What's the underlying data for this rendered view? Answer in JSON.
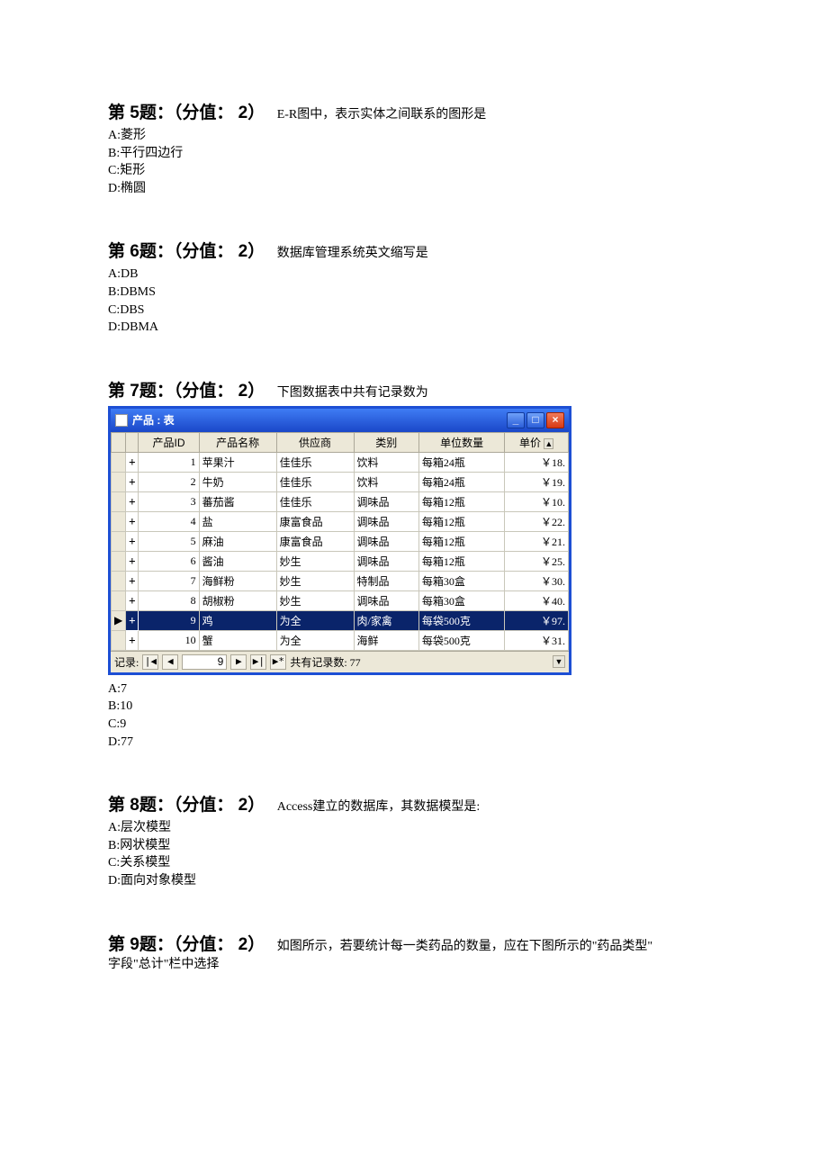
{
  "q5": {
    "title": "第 5题：（分值： 2）",
    "text": "E-R图中，表示实体之间联系的图形是",
    "opts": [
      "A:菱形",
      "B:平行四边行",
      "C:矩形",
      "D:椭圆"
    ]
  },
  "q6": {
    "title": "第 6题：（分值： 2）",
    "text": "数据库管理系统英文缩写是",
    "opts": [
      "A:DB",
      "B:DBMS",
      "C:DBS",
      "D:DBMA"
    ]
  },
  "q7": {
    "title": "第 7题：（分值： 2）",
    "text": "下图数据表中共有记录数为",
    "opts": [
      "A:7",
      "B:10",
      "C:9",
      "D:77"
    ]
  },
  "q8": {
    "title": "第 8题：（分值： 2）",
    "text": "Access建立的数据库，其数据模型是:",
    "opts": [
      "A:层次模型",
      "B:网状模型",
      "C:关系模型",
      "D:面向对象模型"
    ]
  },
  "q9": {
    "title": "第 9题：（分值： 2）",
    "text": "如图所示，若要统计每一类药品的数量，应在下图所示的\"药品类型\"",
    "tail": "字段\"总计\"栏中选择"
  },
  "table": {
    "window_title": "产品 : 表",
    "headers": [
      "产品ID",
      "产品名称",
      "供应商",
      "类别",
      "单位数量",
      "单价"
    ],
    "rows": [
      {
        "id": "1",
        "name": "苹果汁",
        "sup": "佳佳乐",
        "cat": "饮料",
        "unit": "每箱24瓶",
        "price": "￥18."
      },
      {
        "id": "2",
        "name": "牛奶",
        "sup": "佳佳乐",
        "cat": "饮料",
        "unit": "每箱24瓶",
        "price": "￥19."
      },
      {
        "id": "3",
        "name": "蕃茄酱",
        "sup": "佳佳乐",
        "cat": "调味品",
        "unit": "每箱12瓶",
        "price": "￥10."
      },
      {
        "id": "4",
        "name": "盐",
        "sup": "康富食品",
        "cat": "调味品",
        "unit": "每箱12瓶",
        "price": "￥22."
      },
      {
        "id": "5",
        "name": "麻油",
        "sup": "康富食品",
        "cat": "调味品",
        "unit": "每箱12瓶",
        "price": "￥21."
      },
      {
        "id": "6",
        "name": "酱油",
        "sup": "妙生",
        "cat": "调味品",
        "unit": "每箱12瓶",
        "price": "￥25."
      },
      {
        "id": "7",
        "name": "海鲜粉",
        "sup": "妙生",
        "cat": "特制品",
        "unit": "每箱30盒",
        "price": "￥30."
      },
      {
        "id": "8",
        "name": "胡椒粉",
        "sup": "妙生",
        "cat": "调味品",
        "unit": "每箱30盒",
        "price": "￥40."
      },
      {
        "id": "9",
        "name": "鸡",
        "sup": "为全",
        "cat": "肉/家禽",
        "unit": "每袋500克",
        "price": "￥97.",
        "selected": true
      },
      {
        "id": "10",
        "name": "蟹",
        "sup": "为全",
        "cat": "海鲜",
        "unit": "每袋500克",
        "price": "￥31."
      }
    ],
    "nav": {
      "label": "记录:",
      "current": "9",
      "total_label": "共有记录数: 77"
    }
  },
  "winbtns": {
    "min": "_",
    "max": "□",
    "close": "×"
  },
  "plus": "+",
  "navsym": {
    "first": "|◀",
    "prev": "◀",
    "next": "▶",
    "last": "▶|",
    "new": "▶*"
  }
}
